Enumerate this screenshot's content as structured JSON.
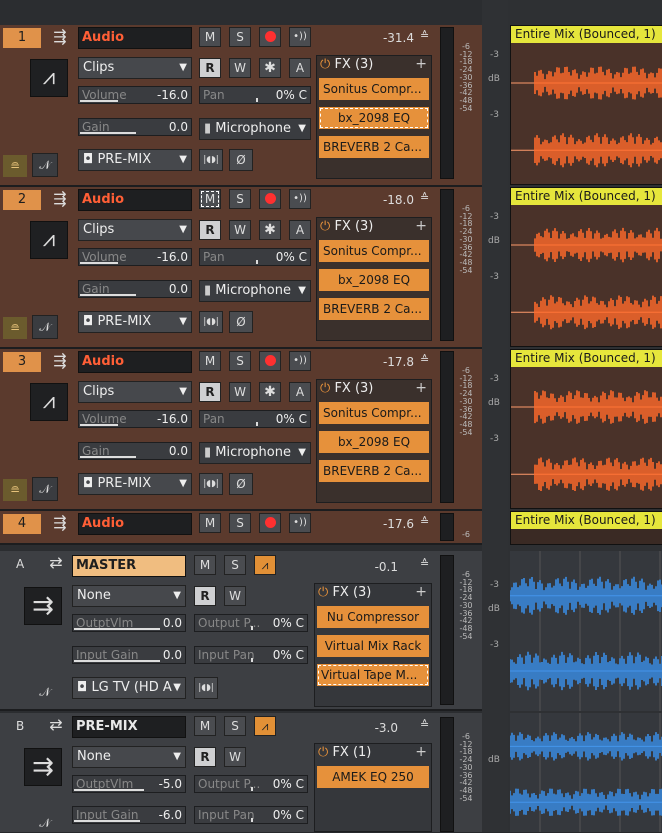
{
  "tracks": [
    {
      "number": "1",
      "name": "Audio",
      "db": "-31.4",
      "mode": "Clips",
      "volume_label": "Volume",
      "volume": "-16.0",
      "pan_label": "Pan",
      "pan": "0% C",
      "gain_label": "Gain",
      "gain": "0.0",
      "input": "Microphone",
      "output": "PRE-MIX",
      "fx_title": "FX (3)",
      "fx": [
        "Sonitus Compr...",
        "bx_2098 EQ",
        "BREVERB 2 Ca..."
      ],
      "clip": "Entire Mix (Bounced, 1)"
    },
    {
      "number": "2",
      "name": "Audio",
      "db": "-18.0",
      "mode": "Clips",
      "volume_label": "Volume",
      "volume": "-16.0",
      "pan_label": "Pan",
      "pan": "0% C",
      "gain_label": "Gain",
      "gain": "0.0",
      "input": "Microphone",
      "output": "PRE-MIX",
      "fx_title": "FX (3)",
      "fx": [
        "Sonitus Compr...",
        "bx_2098 EQ",
        "BREVERB 2 Ca..."
      ],
      "clip": "Entire Mix (Bounced, 1)"
    },
    {
      "number": "3",
      "name": "Audio",
      "db": "-17.8",
      "mode": "Clips",
      "volume_label": "Volume",
      "volume": "-16.0",
      "pan_label": "Pan",
      "pan": "0% C",
      "gain_label": "Gain",
      "gain": "0.0",
      "input": "Microphone",
      "output": "PRE-MIX",
      "fx_title": "FX (3)",
      "fx": [
        "Sonitus Compr...",
        "bx_2098 EQ",
        "BREVERB 2 Ca..."
      ],
      "clip": "Entire Mix (Bounced, 1)"
    },
    {
      "number": "4",
      "name": "Audio",
      "db": "-17.6",
      "clip": "Entire Mix (Bounced, 1)"
    }
  ],
  "buses": [
    {
      "letter": "A",
      "name": "MASTER",
      "db": "-0.1",
      "input": "None",
      "out_vol_label": "OutptVlm",
      "out_vol": "0.0",
      "out_pan_label": "Output P...",
      "out_pan": "0% C",
      "in_gain_label": "Input Gain",
      "in_gain": "0.0",
      "in_pan_label": "Input Pan",
      "in_pan": "0% C",
      "output": "LG TV (HD A",
      "fx_title": "FX (3)",
      "fx": [
        "Nu Compressor",
        "Virtual Mix Rack",
        "Virtual Tape M..."
      ]
    },
    {
      "letter": "B",
      "name": "PRE-MIX",
      "db": "-3.0",
      "input": "None",
      "out_vol_label": "OutptVlm",
      "out_vol": "-5.0",
      "out_pan_label": "Output P...",
      "out_pan": "0% C",
      "in_gain_label": "Input Gain",
      "in_gain": "-6.0",
      "in_pan_label": "Input Pan",
      "in_pan": "0% C",
      "fx_title": "FX (1)",
      "fx": [
        "AMEK EQ 250"
      ]
    }
  ],
  "buttons": {
    "mute": "M",
    "solo": "S",
    "read": "R",
    "write": "W",
    "star": "✱",
    "auto": "A",
    "phase": "Ø",
    "plus": "+"
  },
  "meter_scale": [
    "-6",
    "-12",
    "-18",
    "-24",
    "-30",
    "-36",
    "-42",
    "-48",
    "-54"
  ],
  "lane_labels": [
    "-3",
    "dB",
    "-3"
  ],
  "colors": {
    "track_bg": "#5b3a2d",
    "accent": "#e6913b",
    "track_name": "#ff5f36",
    "clip_header": "#e6e63c",
    "audio_wave": "#ff6a2a",
    "bus_wave": "#3a8ee6"
  }
}
